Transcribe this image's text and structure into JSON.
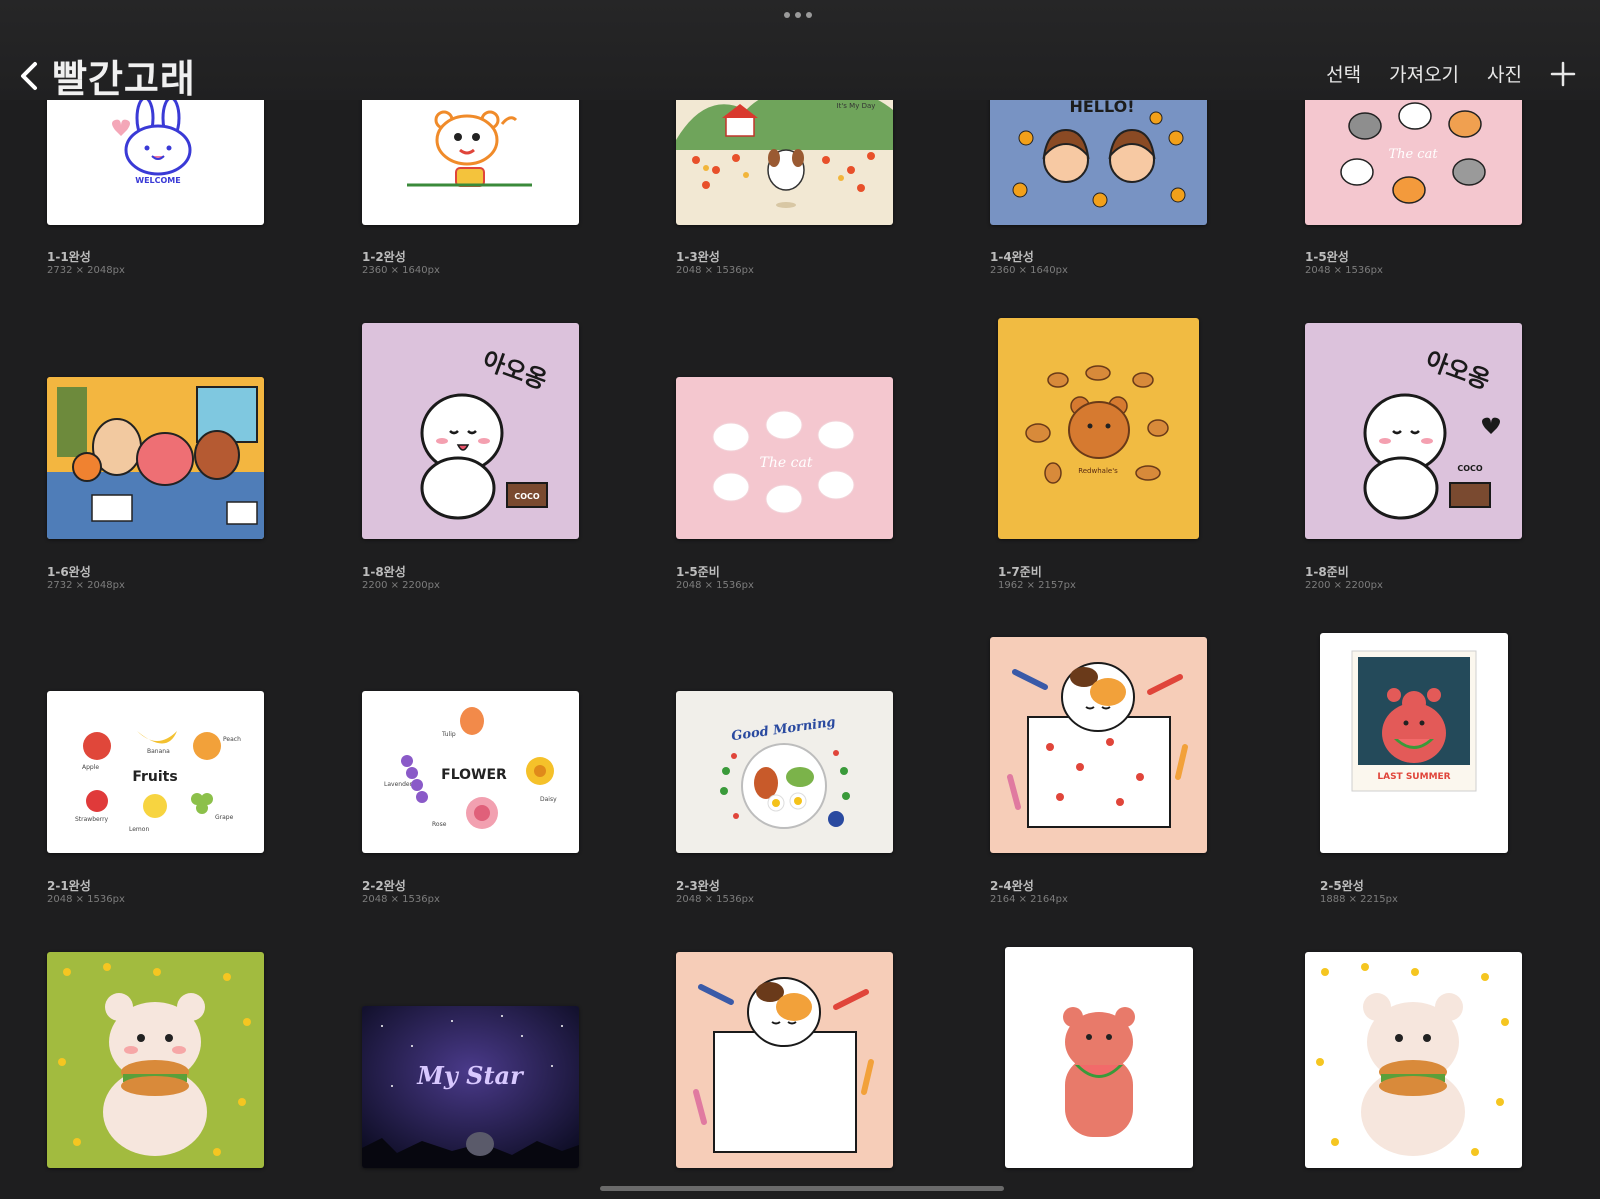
{
  "header": {
    "title": "빨간고래",
    "actions": [
      "선택",
      "가져오기",
      "사진"
    ]
  },
  "artworks": [
    {
      "name": "1-1완성",
      "size": "2732 × 2048px"
    },
    {
      "name": "1-2완성",
      "size": "2360 × 1640px"
    },
    {
      "name": "1-3완성",
      "size": "2048 × 1536px"
    },
    {
      "name": "1-4완성",
      "size": "2360 × 1640px"
    },
    {
      "name": "1-5완성",
      "size": "2048 × 1536px"
    },
    {
      "name": "1-6완성",
      "size": "2732 × 2048px"
    },
    {
      "name": "1-8완성",
      "size": "2200 × 2200px"
    },
    {
      "name": "1-5준비",
      "size": "2048 × 1536px"
    },
    {
      "name": "1-7준비",
      "size": "1962 × 2157px"
    },
    {
      "name": "1-8준비",
      "size": "2200 × 2200px"
    },
    {
      "name": "2-1완성",
      "size": "2048 × 1536px"
    },
    {
      "name": "2-2완성",
      "size": "2048 × 1536px"
    },
    {
      "name": "2-3완성",
      "size": "2048 × 1536px"
    },
    {
      "name": "2-4완성",
      "size": "2164 × 2164px"
    },
    {
      "name": "2-5완성",
      "size": "1888 × 2215px"
    }
  ],
  "art_text": {
    "welcome": "WELCOME",
    "myday": "It's My Day",
    "hello": "HELLO!",
    "thecat": "The cat",
    "aoong": "아오옹",
    "coco": "COCO",
    "redwhale": "Redwhale's",
    "fruits": "Fruits",
    "apple": "Apple",
    "banana": "Banana",
    "peach": "Peach",
    "strawberry": "Strawberry",
    "lemon": "Lemon",
    "grape": "Grape",
    "flower": "FLOWER",
    "tulip": "Tulip",
    "lavender": "Lavender",
    "rose": "Rose",
    "daisy": "Daisy",
    "goodmorning": "Good Morning",
    "lastsummer": "LAST SUMMER",
    "mystar": "My Star"
  },
  "colors": {
    "background": "#1e1e1f",
    "pink": "#f4c7cf",
    "lavender": "#dcc2dc",
    "mustard": "#f1bb42",
    "blue": "#7893c3",
    "peach": "#f6cdb8",
    "green": "#a2bb3f"
  }
}
